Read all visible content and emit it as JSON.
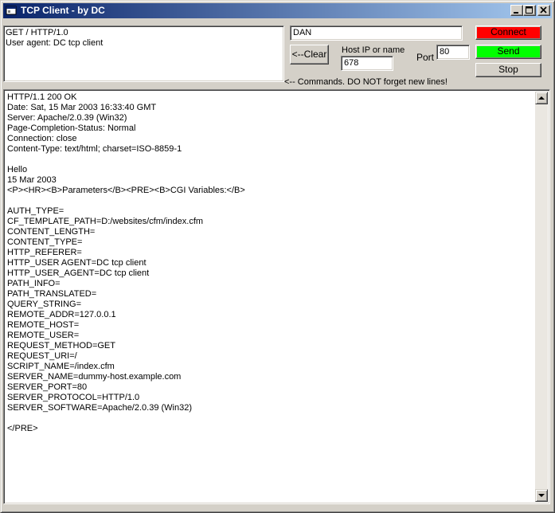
{
  "window": {
    "title": "TCP Client - by DC"
  },
  "command": {
    "text": "GET / HTTP/1.0\nUser agent: DC tcp client"
  },
  "host": {
    "value": "DAN",
    "ip_label": "Host IP or name",
    "ip_value": "678",
    "port_label": "Port",
    "port_value": "80"
  },
  "buttons": {
    "clear": "<--Clear",
    "connect": "Connect",
    "send": "Send",
    "stop": "Stop"
  },
  "hint": "<-- Commands.  DO NOT forget new lines!",
  "output": {
    "text": "HTTP/1.1 200 OK\nDate: Sat, 15 Mar 2003 16:33:40 GMT\nServer: Apache/2.0.39 (Win32)\nPage-Completion-Status: Normal\nConnection: close\nContent-Type: text/html; charset=ISO-8859-1\n\nHello\n15 Mar 2003\n<P><HR><B>Parameters</B><PRE><B>CGI Variables:</B>\n\nAUTH_TYPE=\nCF_TEMPLATE_PATH=D:/websites/cfm/index.cfm\nCONTENT_LENGTH=\nCONTENT_TYPE=\nHTTP_REFERER=\nHTTP_USER AGENT=DC tcp client\nHTTP_USER_AGENT=DC tcp client\nPATH_INFO=\nPATH_TRANSLATED=\nQUERY_STRING=\nREMOTE_ADDR=127.0.0.1\nREMOTE_HOST=\nREMOTE_USER=\nREQUEST_METHOD=GET\nREQUEST_URI=/\nSCRIPT_NAME=/index.cfm\nSERVER_NAME=dummy-host.example.com\nSERVER_PORT=80\nSERVER_PROTOCOL=HTTP/1.0\nSERVER_SOFTWARE=Apache/2.0.39 (Win32)\n\n</PRE>"
  },
  "colors": {
    "connect": "#ff0000",
    "send": "#00ff00",
    "face": "#d4d0c8",
    "title_start": "#0a246a",
    "title_end": "#a6caf0"
  },
  "icons": {
    "app": "window-app-icon",
    "minimize": "minimize-icon",
    "maximize": "maximize-icon",
    "close": "close-icon",
    "scroll_up": "arrow-up-icon",
    "scroll_down": "arrow-down-icon"
  }
}
